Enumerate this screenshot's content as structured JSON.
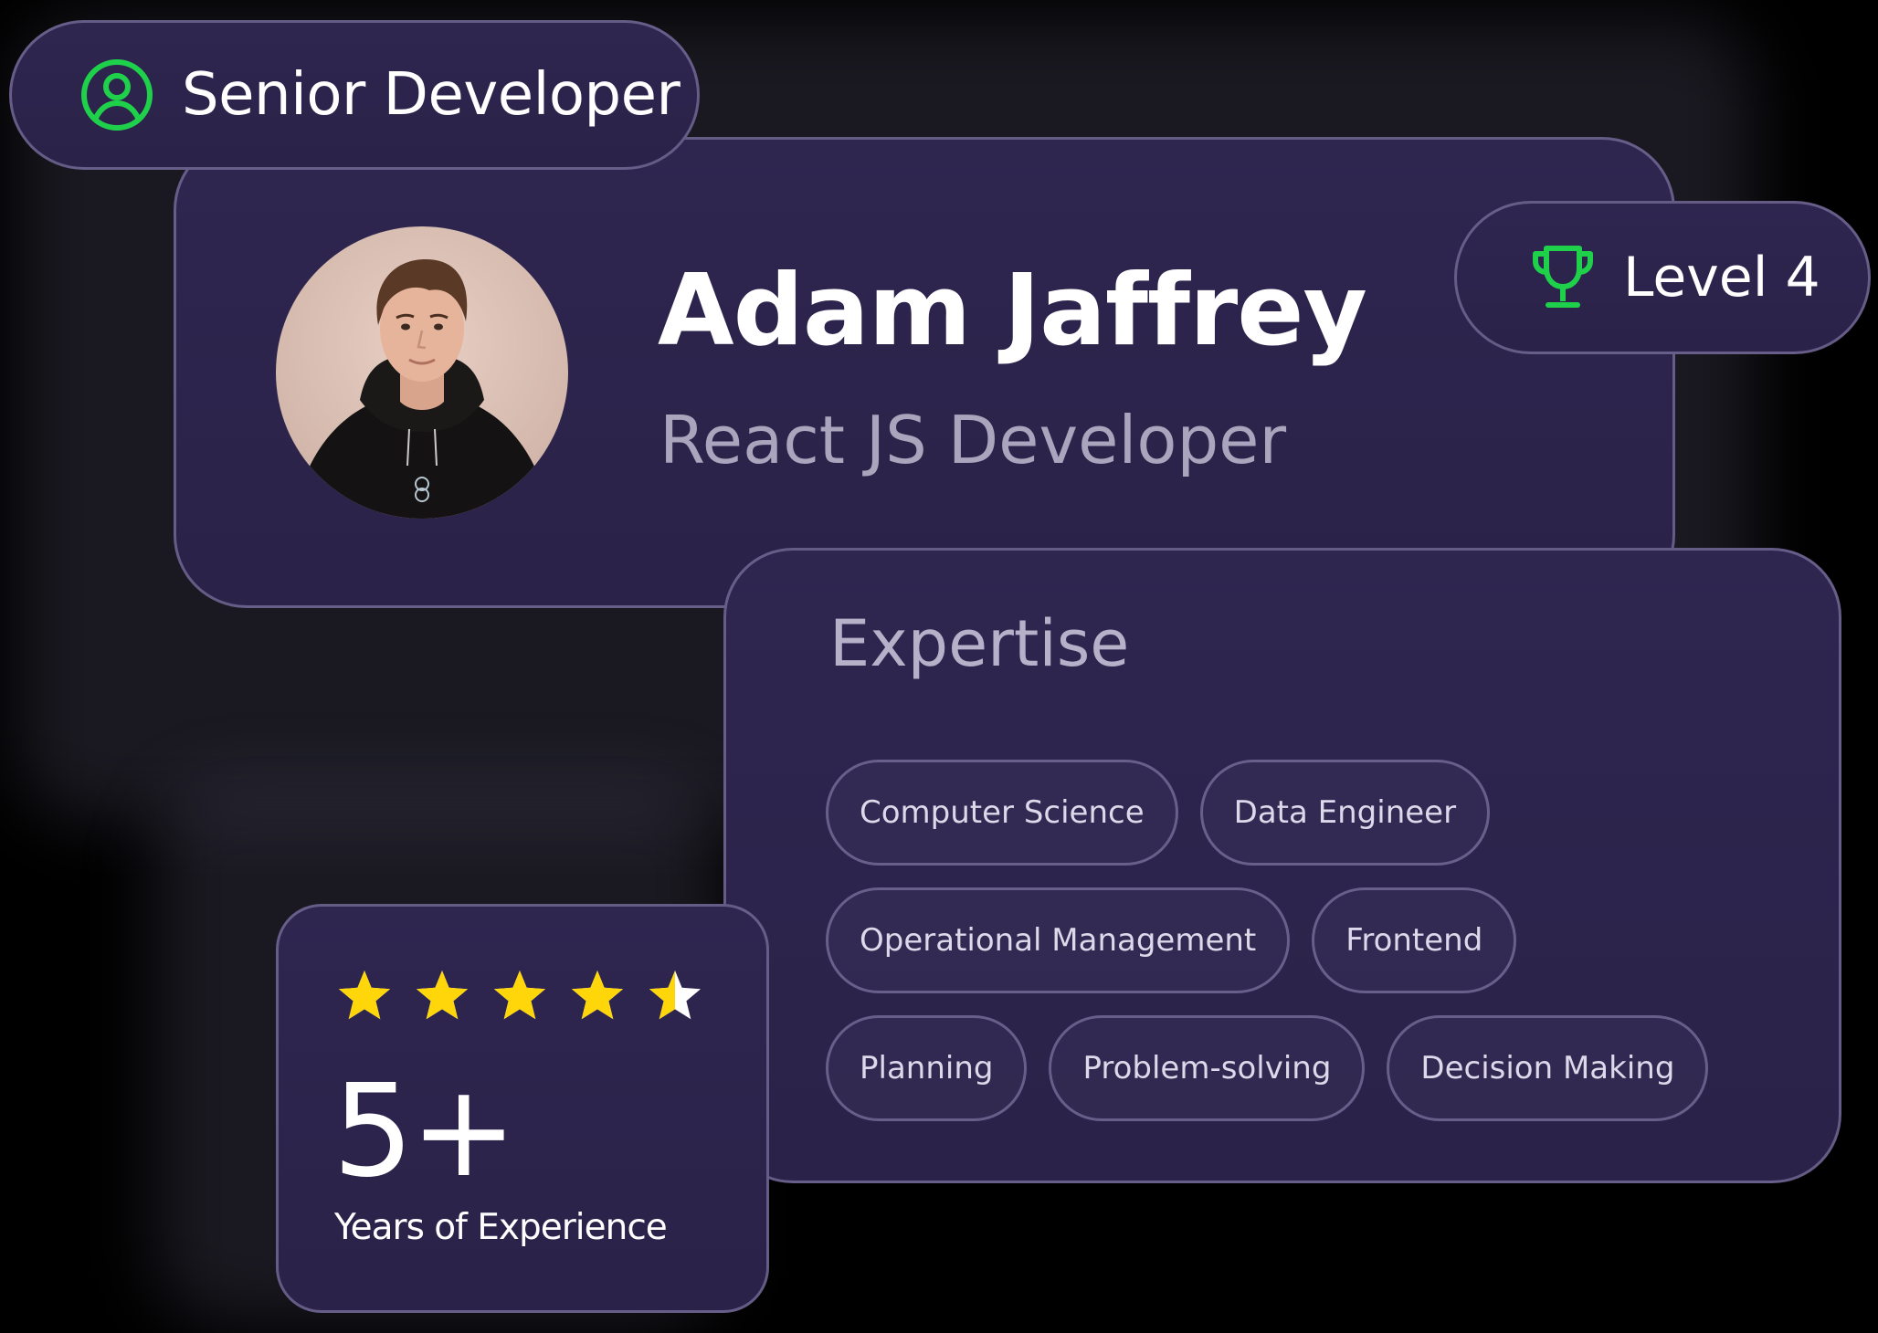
{
  "role_badge": {
    "label": "Senior Developer",
    "icon": "user-circle-icon",
    "icon_color": "#1fd14a"
  },
  "profile": {
    "name": "Adam Jaffrey",
    "title": "React JS Developer"
  },
  "level_badge": {
    "label": "Level 4",
    "icon": "trophy-icon",
    "icon_color": "#1fd14a"
  },
  "expertise": {
    "title": "Expertise",
    "rows": [
      [
        "Computer Science",
        "Data Engineer"
      ],
      [
        "Operational Management",
        "Frontend"
      ],
      [
        "Planning",
        "Problem-solving",
        "Decision Making"
      ]
    ]
  },
  "experience": {
    "rating": 4.5,
    "rating_max": 5,
    "star_color": "#ffd60a",
    "value": "5+",
    "label": "Years of Experience"
  },
  "colors": {
    "background": "#000000",
    "card": "#2c2449",
    "border": "#8c84ad",
    "accent_green": "#1fd14a"
  }
}
